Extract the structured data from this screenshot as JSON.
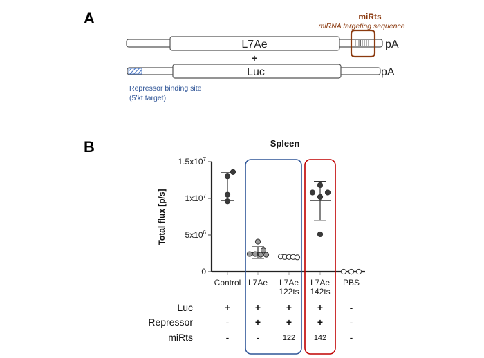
{
  "panel_a": {
    "label": "A",
    "constructs": [
      {
        "name": "L7Ae",
        "tail": "pA"
      },
      {
        "name": "Luc",
        "tail": "pA"
      }
    ],
    "plus": "+",
    "mirts_title": "miRts",
    "mirts_subtitle": "miRNA targeting sequence",
    "repressor_site_line1": "Repressor binding site",
    "repressor_site_line2": "(5’kt target)",
    "colors": {
      "mirts": "#8B3A0F",
      "repressor": "#2F5597"
    }
  },
  "panel_b": {
    "label": "B",
    "conditions_table": {
      "row_labels": [
        "Luc",
        "Repressor",
        "miRts"
      ],
      "rows": [
        [
          "+",
          "+",
          "+",
          "+",
          "-"
        ],
        [
          "-",
          "+",
          "+",
          "+",
          "-"
        ],
        [
          "-",
          "-",
          "122",
          "142",
          "-"
        ]
      ]
    },
    "highlight_colors": {
      "blue_box": "#2F5597",
      "red_box": "#C00000"
    }
  },
  "chart_data": {
    "type": "scatter",
    "title": "Spleen",
    "xlabel": "",
    "ylabel": "Total flux [p/s]",
    "ylim": [
      0,
      15000000
    ],
    "yticks": [
      0,
      5000000,
      10000000,
      15000000
    ],
    "ytick_labels": [
      {
        "base": "0",
        "exp": ""
      },
      {
        "base": "5x10",
        "exp": "6"
      },
      {
        "base": "1x10",
        "exp": "7"
      },
      {
        "base": "1.5x10",
        "exp": "7"
      }
    ],
    "categories": [
      {
        "line1": "Control",
        "line2": ""
      },
      {
        "line1": "L7Ae",
        "line2": ""
      },
      {
        "line1": "L7Ae",
        "line2": "122ts"
      },
      {
        "line1": "L7Ae",
        "line2": "142ts"
      },
      {
        "line1": "PBS",
        "line2": ""
      }
    ],
    "series": [
      {
        "name": "Control",
        "fill": "dark",
        "values": [
          13600000,
          13000000,
          10500000,
          9600000
        ],
        "mean": 11700000,
        "err_low": 9700000,
        "err_high": 13500000,
        "style": "range"
      },
      {
        "name": "L7Ae",
        "fill": "gray",
        "values": [
          4100000,
          2900000,
          2400000,
          2400000,
          2300000,
          2300000
        ],
        "mean": 2600000,
        "err_low": 1800000,
        "err_high": 3400000,
        "style": "meansd"
      },
      {
        "name": "L7Ae 122ts",
        "fill": "open",
        "values": [
          2050000,
          2000000,
          2000000,
          2000000,
          1950000
        ],
        "mean": 2000000,
        "err_low": 1950000,
        "err_high": 2050000,
        "style": "meansd"
      },
      {
        "name": "L7Ae 142ts",
        "fill": "dark",
        "values": [
          11800000,
          10800000,
          10800000,
          10200000,
          5100000
        ],
        "mean": 9700000,
        "err_low": 7000000,
        "err_high": 12300000,
        "style": "meansd"
      },
      {
        "name": "PBS",
        "fill": "open",
        "values": [
          0,
          0,
          0
        ],
        "mean": 0,
        "err_low": 0,
        "err_high": 0,
        "style": "none"
      }
    ],
    "grid": false,
    "legend": "none"
  }
}
